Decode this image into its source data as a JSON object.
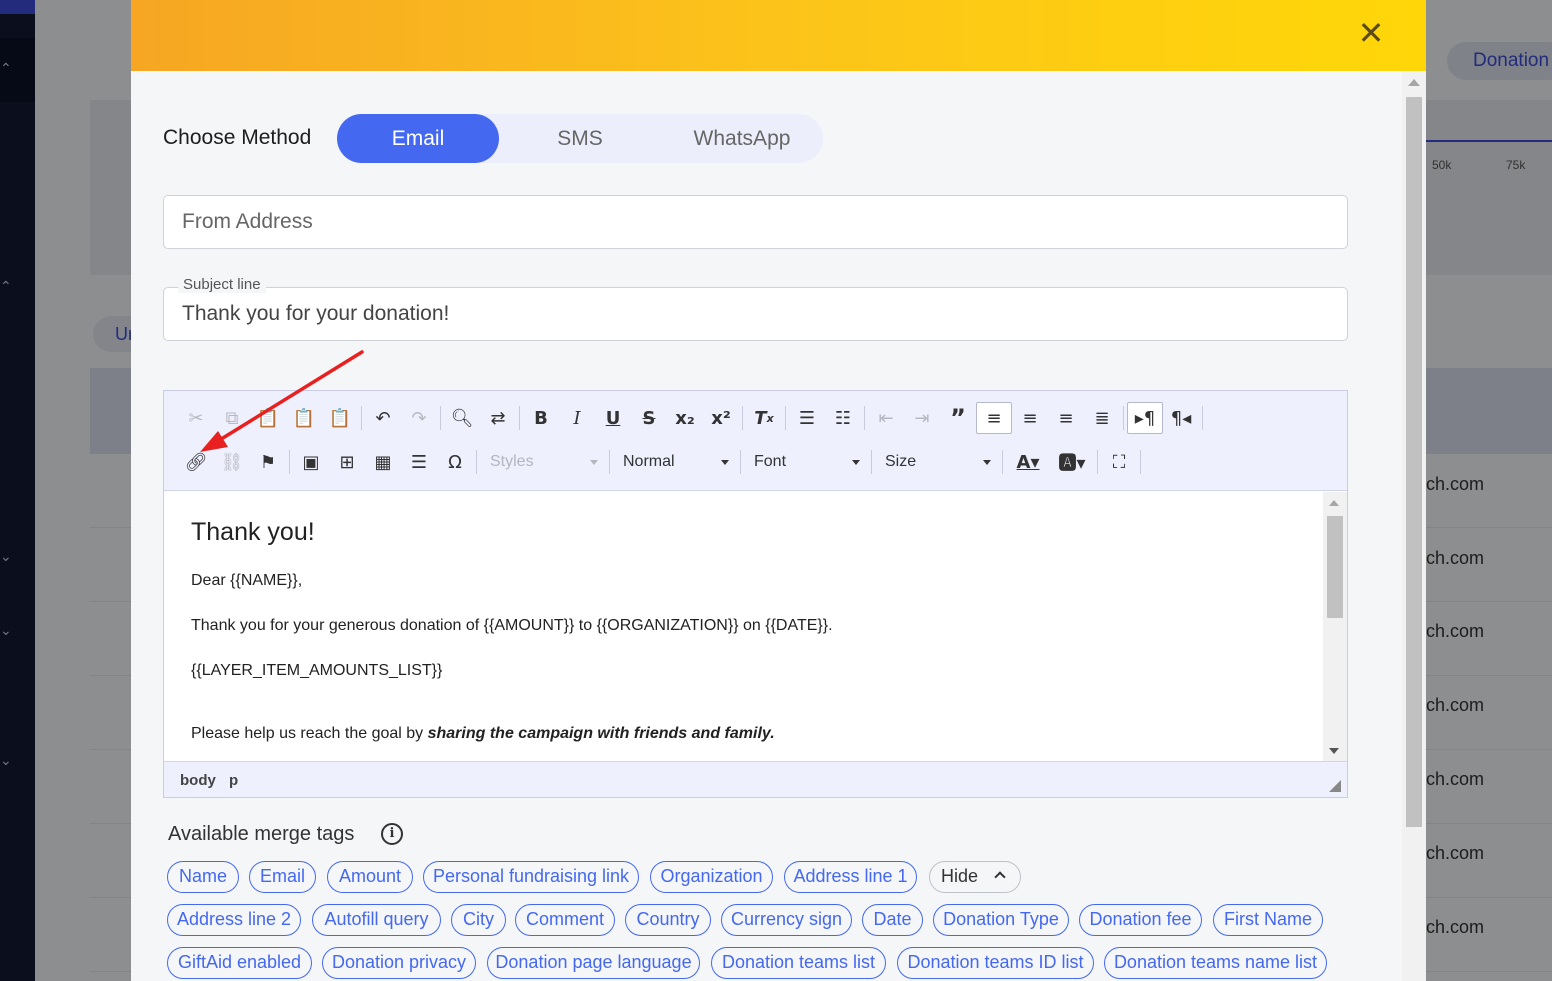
{
  "background": {
    "donation_pill": "Donation",
    "tab_partial": "Ur",
    "axis_ticks": [
      "50k",
      "75k"
    ],
    "emails": [
      "ch.com",
      "ch.com",
      "ch.com",
      "ch.com",
      "ch.com",
      "ch.com",
      "ch.com"
    ]
  },
  "modal": {
    "close_icon": "close-icon",
    "choose_method_label": "Choose Method",
    "methods": [
      "Email",
      "SMS",
      "WhatsApp"
    ],
    "active_method": "Email",
    "from_address": {
      "placeholder": "From Address",
      "value": ""
    },
    "subject": {
      "legend": "Subject line",
      "value": "Thank you for your donation!"
    },
    "editor": {
      "toolbar_row1": [
        "cut-icon",
        "copy-icon",
        "paste-icon",
        "paste-text-icon",
        "paste-word-icon",
        "undo-icon",
        "redo-icon",
        "find-icon",
        "replace-icon",
        "bold-icon",
        "italic-icon",
        "underline-icon",
        "strikethrough-icon",
        "subscript-icon",
        "superscript-icon",
        "remove-format-icon",
        "numbered-list-icon",
        "bulleted-list-icon",
        "decrease-indent-icon",
        "increase-indent-icon",
        "blockquote-icon",
        "align-left-icon",
        "align-center-icon",
        "align-right-icon",
        "justify-icon",
        "ltr-icon",
        "rtl-icon"
      ],
      "toolbar_row2": [
        "link-icon",
        "unlink-icon",
        "anchor-icon",
        "image-icon",
        "template-icon",
        "table-icon",
        "horizontal-line-icon",
        "special-char-icon",
        "text-color-icon",
        "background-color-icon",
        "maximize-icon"
      ],
      "styles_combo": "Styles",
      "format_combo": "Normal",
      "font_combo": "Font",
      "size_combo": "Size",
      "content": {
        "heading": "Thank you!",
        "greeting": "Dear {{NAME}},",
        "body": "Thank you for your generous donation of {{AMOUNT}} to {{ORGANIZATION}} on {{DATE}}.",
        "list_tag": "{{LAYER_ITEM_AMOUNTS_LIST}}",
        "help_prefix": "Please help us reach the goal by ",
        "help_emphasis": "sharing the campaign with friends and family."
      },
      "status_path": [
        "body",
        "p"
      ]
    },
    "merge_tags": {
      "title": "Available merge tags",
      "hide_label": "Hide",
      "row1": [
        "Name",
        "Email",
        "Amount",
        "Personal fundraising link",
        "Organization",
        "Address line 1"
      ],
      "row2": [
        "Address line 2",
        "Autofill query",
        "City",
        "Comment",
        "Country",
        "Currency sign",
        "Date",
        "Donation Type",
        "Donation fee",
        "First Name"
      ],
      "row3": [
        "GiftAid enabled",
        "Donation privacy",
        "Donation page language",
        "Donation teams list",
        "Donation teams ID list",
        "Donation teams name list"
      ]
    }
  },
  "colors": {
    "header_gradient_start": "#f6a623",
    "header_gradient_end": "#ffd708",
    "accent": "#4468f0",
    "annotation_arrow": "#e8201f"
  }
}
